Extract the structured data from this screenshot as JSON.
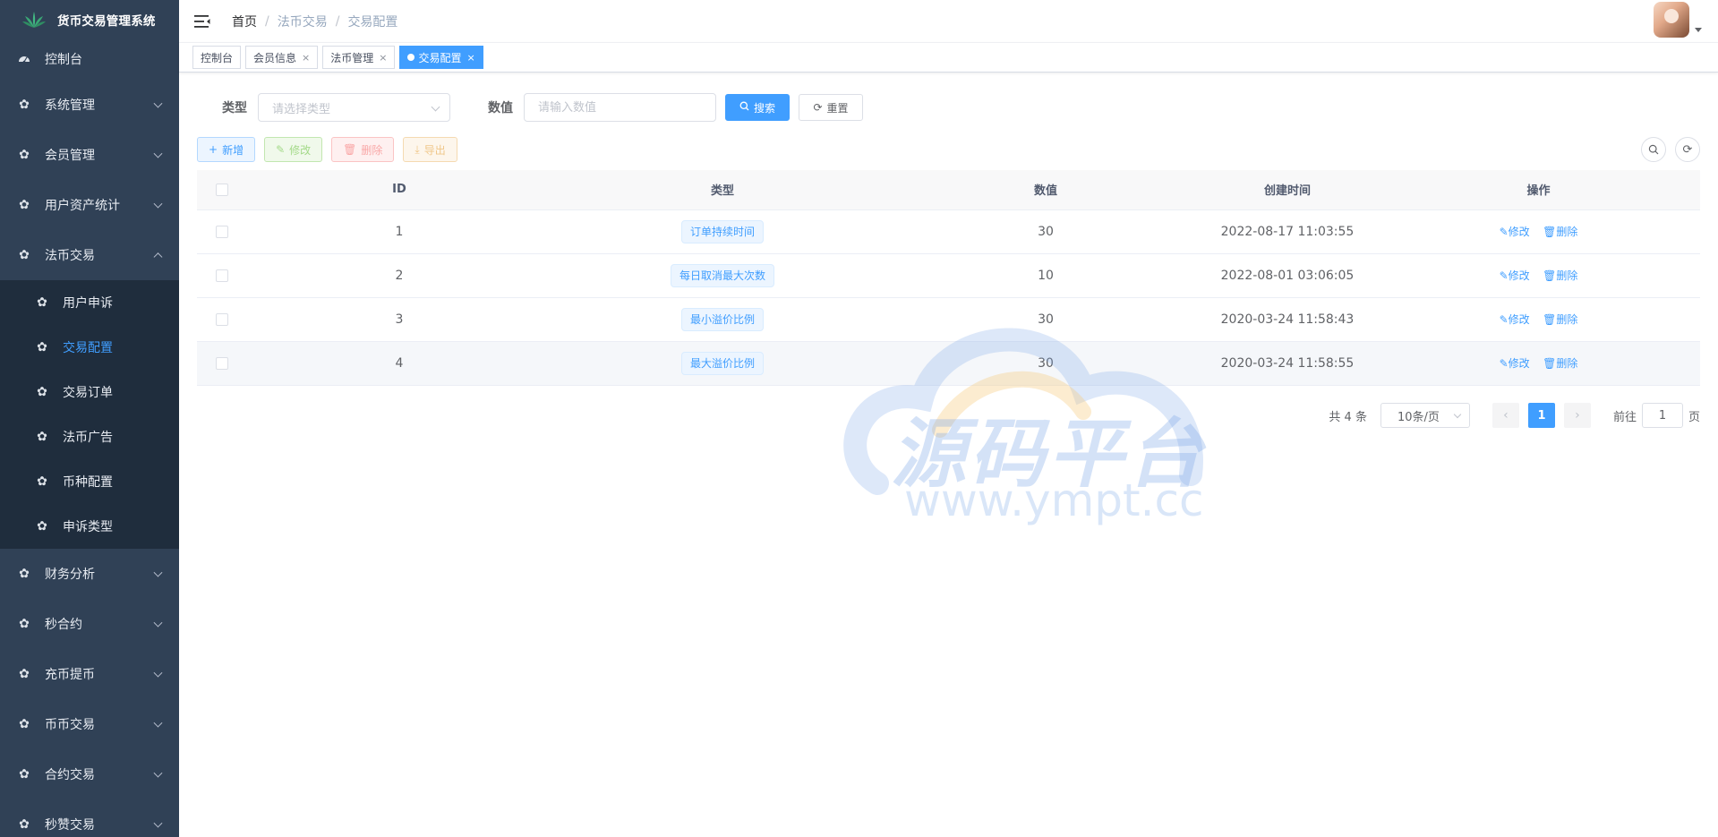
{
  "app": {
    "title": "货币交易管理系统"
  },
  "sidebar": {
    "items": [
      {
        "label": "控制台"
      },
      {
        "label": "系统管理"
      },
      {
        "label": "会员管理"
      },
      {
        "label": "用户资产统计"
      },
      {
        "label": "法币交易"
      },
      {
        "label": "财务分析"
      },
      {
        "label": "秒合约"
      },
      {
        "label": "充币提币"
      },
      {
        "label": "币币交易"
      },
      {
        "label": "合约交易"
      },
      {
        "label": "秒赞交易"
      }
    ],
    "sub_items": [
      {
        "label": "用户申诉"
      },
      {
        "label": "交易配置"
      },
      {
        "label": "交易订单"
      },
      {
        "label": "法币广告"
      },
      {
        "label": "币种配置"
      },
      {
        "label": "申诉类型"
      }
    ]
  },
  "breadcrumb": [
    "首页",
    "法币交易",
    "交易配置"
  ],
  "tags": [
    "控制台",
    "会员信息",
    "法币管理",
    "交易配置"
  ],
  "search": {
    "type_label": "类型",
    "type_placeholder": "请选择类型",
    "value_label": "数值",
    "value_placeholder": "请输入数值",
    "search_btn": "搜索",
    "reset_btn": "重置"
  },
  "toolbar": {
    "add": "新增",
    "edit": "修改",
    "delete": "删除",
    "export": "导出"
  },
  "table": {
    "headers": [
      "ID",
      "类型",
      "数值",
      "创建时间",
      "操作"
    ],
    "rows": [
      {
        "id": "1",
        "type": "订单持续时间",
        "value": "30",
        "created": "2022-08-17 11:03:55"
      },
      {
        "id": "2",
        "type": "每日取消最大次数",
        "value": "10",
        "created": "2022-08-01 03:06:05"
      },
      {
        "id": "3",
        "type": "最小溢价比例",
        "value": "30",
        "created": "2020-03-24 11:58:43"
      },
      {
        "id": "4",
        "type": "最大溢价比例",
        "value": "30",
        "created": "2020-03-24 11:58:55"
      }
    ],
    "op_edit": "修改",
    "op_delete": "删除"
  },
  "pagination": {
    "total": "共 4 条",
    "page_size": "10条/页",
    "current": "1",
    "goto_prefix": "前往",
    "goto_value": "1",
    "goto_suffix": "页"
  },
  "watermark": {
    "text": "源码平台",
    "url": "www.ympt.cc"
  },
  "colors": {
    "sidebar_bg": "#304156",
    "submenu_bg": "#1f2d3d",
    "primary": "#409eff"
  }
}
